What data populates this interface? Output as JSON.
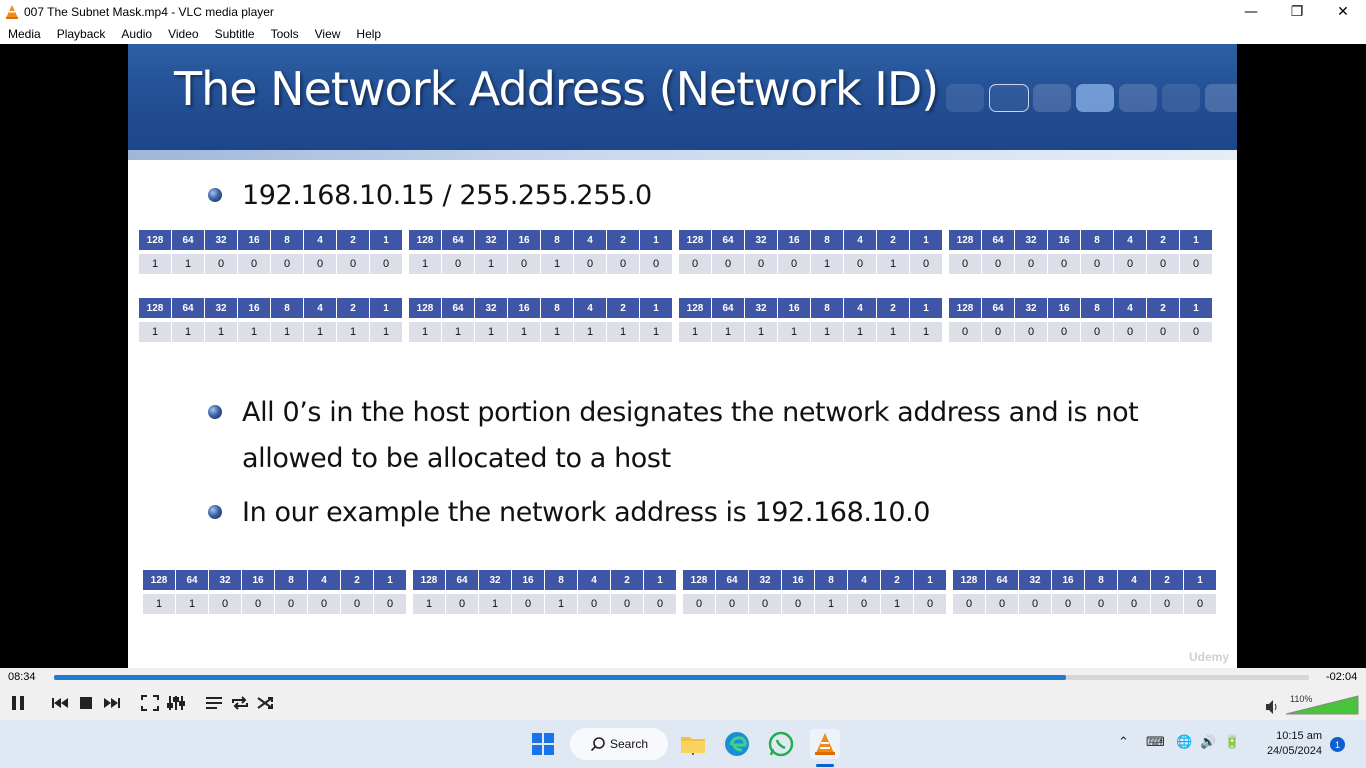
{
  "window": {
    "title": "007 The Subnet Mask.mp4 - VLC media player",
    "minimize_icon": "minimize-icon",
    "maximize_icon": "restore-icon",
    "close_icon": "close-icon"
  },
  "menu": [
    "Media",
    "Playback",
    "Audio",
    "Video",
    "Subtitle",
    "Tools",
    "View",
    "Help"
  ],
  "slide": {
    "title": "The Network Address (Network ID)",
    "bullet1": "192.168.10.15 / 255.255.255.0",
    "bullet2_line1": "All 0’s in the host portion designates the network address and is not",
    "bullet2_line2": "allowed to be allocated to a host",
    "bullet3": "In our example the network address is 192.168.10.0",
    "watermark": "Udemy",
    "header_colors": [
      "#2d5fa3",
      "#1c4488"
    ],
    "bit_header_color": "#3f56a6",
    "bit_value_color": "#dcdfe8",
    "bit_headers": [
      "128",
      "64",
      "32",
      "16",
      "8",
      "4",
      "2",
      "1"
    ],
    "tables": [
      {
        "name": "ip-address-bits",
        "octets": [
          [
            "1",
            "1",
            "0",
            "0",
            "0",
            "0",
            "0",
            "0"
          ],
          [
            "1",
            "0",
            "1",
            "0",
            "1",
            "0",
            "0",
            "0"
          ],
          [
            "0",
            "0",
            "0",
            "0",
            "1",
            "0",
            "1",
            "0"
          ],
          [
            "0",
            "0",
            "0",
            "0",
            "0",
            "0",
            "0",
            "0"
          ]
        ]
      },
      {
        "name": "subnet-mask-bits",
        "octets": [
          [
            "1",
            "1",
            "1",
            "1",
            "1",
            "1",
            "1",
            "1"
          ],
          [
            "1",
            "1",
            "1",
            "1",
            "1",
            "1",
            "1",
            "1"
          ],
          [
            "1",
            "1",
            "1",
            "1",
            "1",
            "1",
            "1",
            "1"
          ],
          [
            "0",
            "0",
            "0",
            "0",
            "0",
            "0",
            "0",
            "0"
          ]
        ]
      },
      {
        "name": "network-address-bits",
        "octets": [
          [
            "1",
            "1",
            "0",
            "0",
            "0",
            "0",
            "0",
            "0"
          ],
          [
            "1",
            "0",
            "1",
            "0",
            "1",
            "0",
            "0",
            "0"
          ],
          [
            "0",
            "0",
            "0",
            "0",
            "1",
            "0",
            "1",
            "0"
          ],
          [
            "0",
            "0",
            "0",
            "0",
            "0",
            "0",
            "0",
            "0"
          ]
        ]
      }
    ]
  },
  "player": {
    "elapsed": "08:34",
    "remaining": "-02:04",
    "progress_fraction": 0.806,
    "volume_percent": "110%",
    "accent_color": "#1e7ad6"
  },
  "taskbar": {
    "search_label": "Search",
    "time": "10:15 am",
    "date": "24/05/2024",
    "notifications": "1"
  }
}
